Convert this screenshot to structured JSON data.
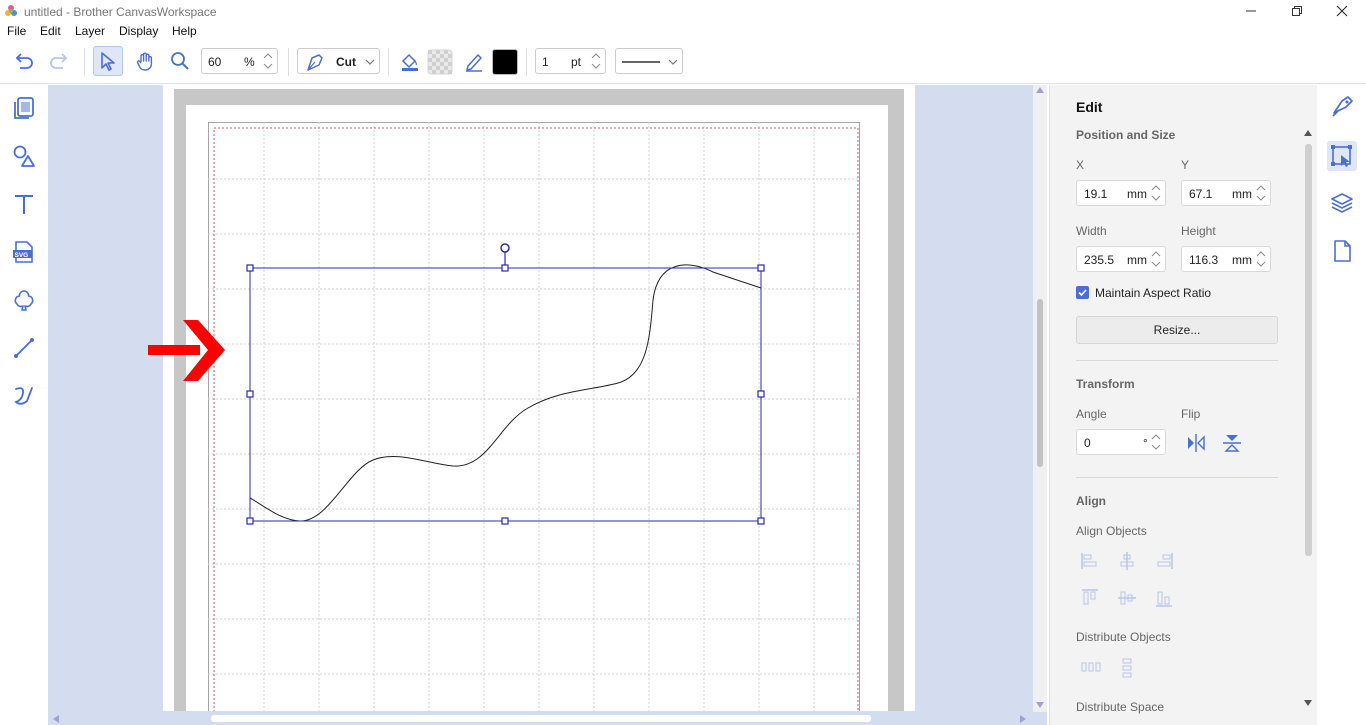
{
  "window": {
    "title": "untitled - Brother CanvasWorkspace"
  },
  "menu": {
    "items": [
      "File",
      "Edit",
      "Layer",
      "Display",
      "Help"
    ]
  },
  "toolbar": {
    "zoom_value": "60",
    "zoom_unit": "%",
    "mode_label": "Cut",
    "line_width_value": "1",
    "line_width_unit": "pt",
    "fill_color": "#000000",
    "accent_color": "#4a6fd4"
  },
  "panel": {
    "title": "Edit",
    "position_size": {
      "heading": "Position and Size",
      "x_label": "X",
      "x_value": "19.1",
      "x_unit": "mm",
      "y_label": "Y",
      "y_value": "67.1",
      "y_unit": "mm",
      "width_label": "Width",
      "width_value": "235.5",
      "width_unit": "mm",
      "height_label": "Height",
      "height_value": "116.3",
      "height_unit": "mm",
      "maintain_label": "Maintain Aspect Ratio",
      "maintain_checked": true,
      "resize_label": "Resize..."
    },
    "transform": {
      "heading": "Transform",
      "angle_label": "Angle",
      "angle_value": "0",
      "angle_unit": "°",
      "flip_label": "Flip"
    },
    "align": {
      "heading": "Align",
      "align_objects_label": "Align Objects",
      "distribute_objects_label": "Distribute Objects",
      "distribute_space_label": "Distribute Space"
    }
  },
  "icons": {
    "left": [
      "templates-icon",
      "shapes-icon",
      "text-icon",
      "svg-import-icon",
      "pattern-icon",
      "line-icon",
      "freehand-icon"
    ],
    "right": [
      "cutting-settings-icon",
      "edit-object-icon",
      "layers-icon",
      "page-icon"
    ]
  }
}
